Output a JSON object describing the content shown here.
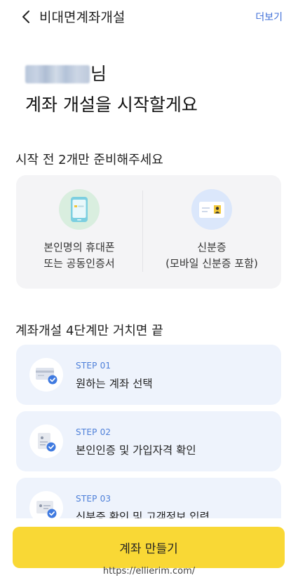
{
  "header": {
    "title": "비대면계좌개설",
    "more_label": "더보기"
  },
  "greeting": {
    "name_suffix": "님",
    "headline": "계좌 개설을 시작할게요"
  },
  "prep": {
    "title": "시작 전 2개만 준비해주세요",
    "items": [
      {
        "line1": "본인명의 휴대폰",
        "line2": "또는 공동인증서",
        "icon": "phone-icon"
      },
      {
        "line1": "신분증",
        "line2": "(모바일 신분증 포함)",
        "icon": "id-card-icon"
      }
    ]
  },
  "steps": {
    "title": "계좌개설 4단계만 거치면 끝",
    "items": [
      {
        "label": "STEP 01",
        "text": "원하는 계좌 선택",
        "icon": "account-card-icon"
      },
      {
        "label": "STEP 02",
        "text": "본인인증 및 가입자격 확인",
        "icon": "id-check-icon"
      },
      {
        "label": "STEP 03",
        "text": "신분증 확인 및 고객정보 입력",
        "icon": "id-check-icon"
      }
    ]
  },
  "cta": {
    "label": "계좌 만들기"
  },
  "watermark": "https://ellierim.com/",
  "colors": {
    "accent_blue": "#3f6fd8",
    "cta_yellow": "#f9d835",
    "step_bg": "#eef3fc",
    "prep_bg": "#f4f4f6"
  }
}
